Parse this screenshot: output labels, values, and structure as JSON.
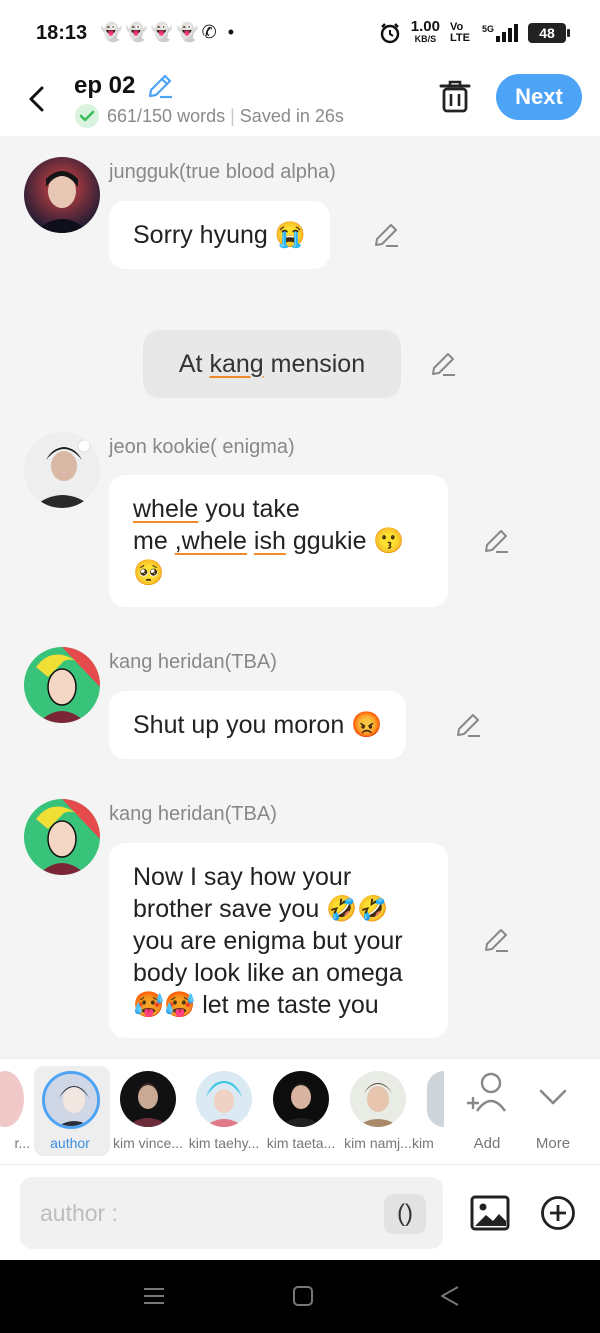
{
  "status_bar": {
    "time": "18:13",
    "notifications": "👻👻👻👻✆ •",
    "speed": "1.00",
    "speed_unit": "KB/S",
    "volte": "Vo LTE",
    "network": "5G",
    "battery": "48"
  },
  "header": {
    "title": "ep 02",
    "word_count": "661/150 words",
    "saved": "Saved in 26s",
    "next_label": "Next"
  },
  "messages": [
    {
      "name": "jungguk(true blood alpha)",
      "lines": [
        "Sorry hyung 😭"
      ]
    },
    {
      "narration": true,
      "parts": [
        "At ",
        "kang",
        " mension"
      ]
    },
    {
      "name": "jeon kookie( enigma)",
      "lines": [
        "whele you take",
        "me ,whele ish ggukie 😗",
        "🥺"
      ]
    },
    {
      "name": "kang heridan(TBA)",
      "lines": [
        "Shut up you moron 😡"
      ]
    },
    {
      "name": "kang heridan(TBA)",
      "lines": [
        "Now I say how your",
        "brother save you 🤣🤣",
        "you are enigma but your",
        "body look like an omega",
        "🥵🥵 let me taste you"
      ]
    }
  ],
  "characters": [
    {
      "label": "r...",
      "partial": true
    },
    {
      "label": "author",
      "selected": true
    },
    {
      "label": "kim vince..."
    },
    {
      "label": "kim taehy..."
    },
    {
      "label": "kim taeta..."
    },
    {
      "label": "kim namj..."
    },
    {
      "label": "kim",
      "partial": true
    }
  ],
  "tools": {
    "add_label": "Add",
    "more_label": "More"
  },
  "composer": {
    "placeholder": "author :",
    "paren": "()"
  },
  "colors": {
    "accent": "#4da3f5",
    "underline": "#f08a2a",
    "check_green": "#3cbf5a"
  },
  "icons": [
    "back-icon",
    "pencil-icon",
    "check-icon",
    "trash-icon",
    "add-person-icon",
    "chevron-down-icon",
    "image-icon",
    "plus-circle-icon",
    "menu-icon",
    "home-square-icon",
    "back-triangle-icon"
  ]
}
